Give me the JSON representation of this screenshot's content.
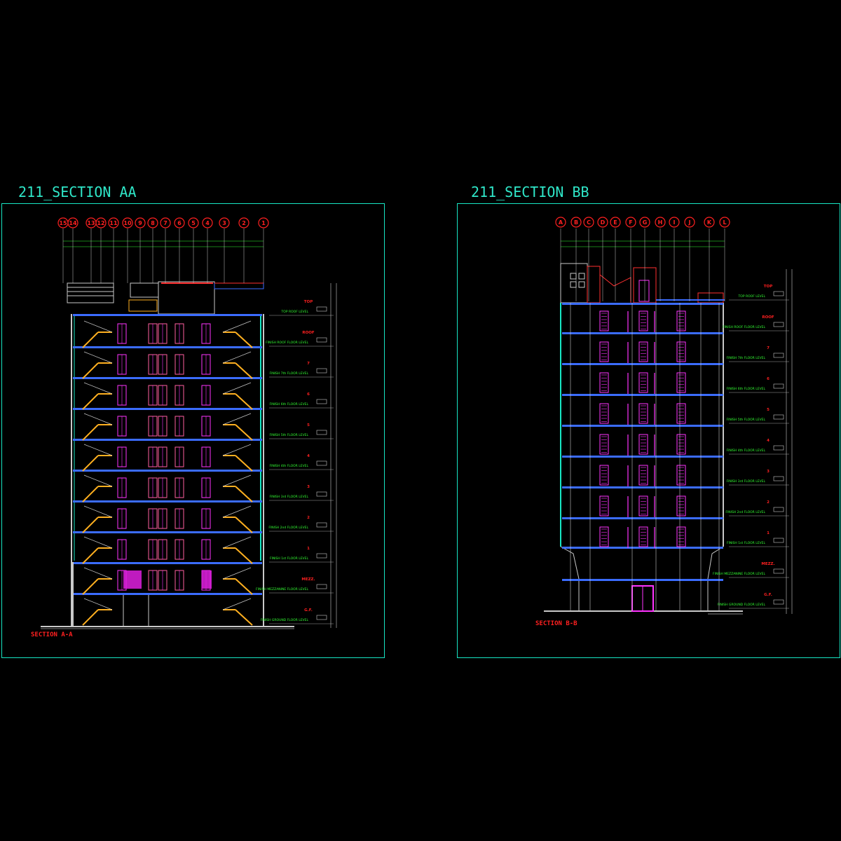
{
  "sectionA": {
    "title": "211_SECTION AA",
    "caption": "SECTION A-A",
    "grid_labels": [
      "15",
      "14",
      "13",
      "12",
      "11",
      "10",
      "9",
      "8",
      "7",
      "6",
      "5",
      "4",
      "3",
      "2",
      "1"
    ],
    "level_names": [
      "TOP",
      "ROOF",
      "7",
      "6",
      "5",
      "4",
      "3",
      "2",
      "1",
      "MEZZ.",
      "G.F."
    ],
    "level_notes": [
      "TOP ROOF LEVEL",
      "FINISH ROOF FLOOR LEVEL",
      "FINISH 7th FLOOR LEVEL",
      "FINISH 6th FLOOR LEVEL",
      "FINISH 5th FLOOR LEVEL",
      "FINISH 4th FLOOR LEVEL",
      "FINISH 3rd FLOOR LEVEL",
      "FINISH 2nd FLOOR LEVEL",
      "FINISH 1st FLOOR LEVEL",
      "FINISH MEZZANINE FLOOR LEVEL",
      "FINISH GROUND FLOOR LEVEL"
    ]
  },
  "sectionB": {
    "title": "211_SECTION BB",
    "caption": "SECTION B-B",
    "grid_labels": [
      "A",
      "B",
      "C",
      "D",
      "E",
      "F",
      "G",
      "H",
      "I",
      "J",
      "K",
      "L"
    ],
    "level_names": [
      "TOP",
      "ROOF",
      "7",
      "6",
      "5",
      "4",
      "3",
      "2",
      "1",
      "MEZZ.",
      "G.F."
    ],
    "level_notes": [
      "TOP ROOF LEVEL",
      "FINISH ROOF FLOOR LEVEL",
      "FINISH 7th FLOOR LEVEL",
      "FINISH 6th FLOOR LEVEL",
      "FINISH 5th FLOOR LEVEL",
      "FINISH 4th FLOOR LEVEL",
      "FINISH 3rd FLOOR LEVEL",
      "FINISH 2nd FLOOR LEVEL",
      "FINISH 1st FLOOR LEVEL",
      "FINISH MEZZANINE FLOOR LEVEL",
      "FINISH GROUND FLOOR LEVEL"
    ]
  },
  "colors": {
    "frame": "#17e6c4",
    "title": "#2fe6c8",
    "grid_bubble": "#ff2020",
    "slab": "#3b6cff",
    "stair": "#ffb020",
    "door": "#ff33ff",
    "note": "#33ff33",
    "caption": "#ff2020"
  }
}
